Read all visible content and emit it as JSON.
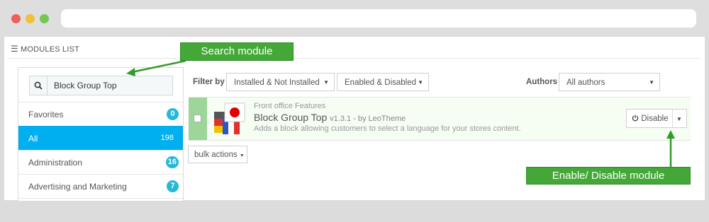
{
  "colors": {
    "accent": "#00aff0",
    "badge": "#25b9d7",
    "callout_green": "#43a838",
    "module_check_green": "#9cd698",
    "window_red": "#ec6158",
    "window_yellow": "#f1bf3a",
    "window_green": "#74c751"
  },
  "panel": {
    "title": "MODULES LIST",
    "icon": "list-icon"
  },
  "sidebar": {
    "search": {
      "icon": "search-icon",
      "value": "Block Group Top"
    },
    "items": [
      {
        "label": "Favorites",
        "count": "0",
        "active": false
      },
      {
        "label": "All",
        "count": "198",
        "active": true
      },
      {
        "label": "Administration",
        "count": "16",
        "active": false
      },
      {
        "label": "Advertising and Marketing",
        "count": "7",
        "active": false
      }
    ]
  },
  "filters": {
    "filter_by_label": "Filter by",
    "install_select": "Installed & Not Installed",
    "enabled_select": "Enabled & Disabled",
    "authors_label": "Authors",
    "authors_select": "All authors"
  },
  "module": {
    "category": "Front office Features",
    "name": "Block Group Top",
    "version": "v1.3.1 - by LeoTheme",
    "description": "Adds a block allowing customers to select a language for your stores content.",
    "action_label": "Disable",
    "action_icon": "power-icon"
  },
  "bulk_actions": "bulk actions",
  "callouts": {
    "search": "Search module",
    "enable": "Enable/ Disable module"
  }
}
